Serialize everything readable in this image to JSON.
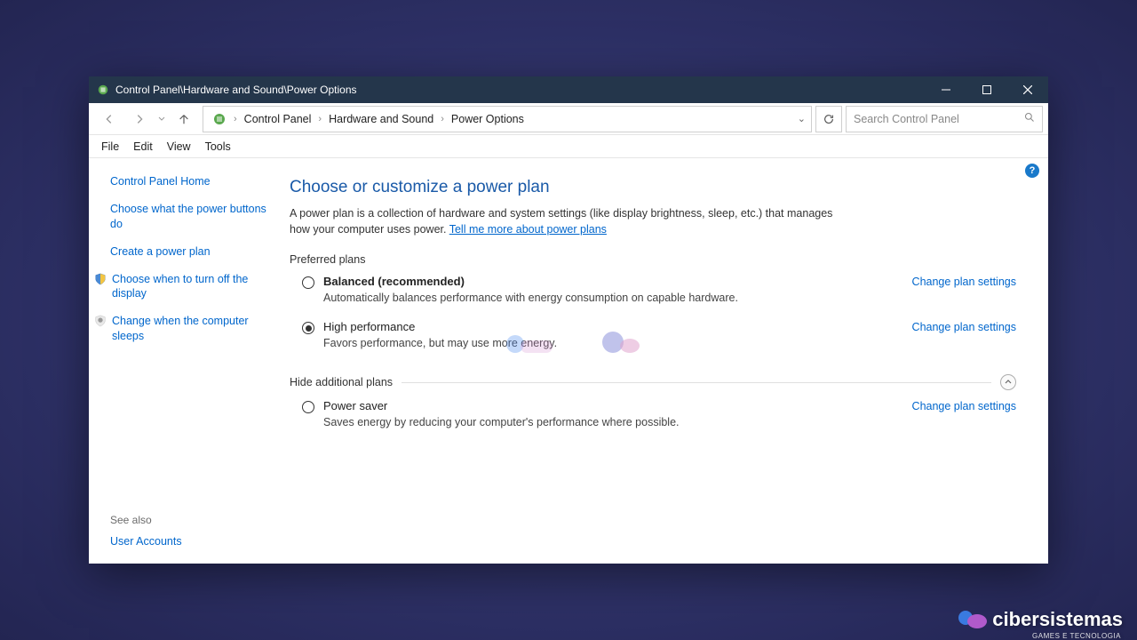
{
  "titlebar": {
    "title": "Control Panel\\Hardware and Sound\\Power Options"
  },
  "breadcrumbs": {
    "item0": "Control Panel",
    "item1": "Hardware and Sound",
    "item2": "Power Options"
  },
  "search": {
    "placeholder": "Search Control Panel"
  },
  "menu": {
    "file": "File",
    "edit": "Edit",
    "view": "View",
    "tools": "Tools"
  },
  "sidebar": {
    "home": "Control Panel Home",
    "link0": "Choose what the power buttons do",
    "link1": "Create a power plan",
    "link2": "Choose when to turn off the display",
    "link3": "Change when the computer sleeps",
    "see_also_label": "See also",
    "see_also_0": "User Accounts"
  },
  "main": {
    "heading": "Choose or customize a power plan",
    "desc_a": "A power plan is a collection of hardware and system settings (like display brightness, sleep, etc.) that manages how your computer uses power. ",
    "desc_link": "Tell me more about power plans",
    "preferred_label": "Preferred plans",
    "additional_label": "Hide additional plans",
    "change_label": "Change plan settings",
    "plans": {
      "balanced": {
        "name": "Balanced (recommended)",
        "desc": "Automatically balances performance with energy consumption on capable hardware."
      },
      "high": {
        "name": "High performance",
        "desc": "Favors performance, but may use more energy."
      },
      "saver": {
        "name": "Power saver",
        "desc": "Saves energy by reducing your computer's performance where possible."
      }
    }
  },
  "watermark": {
    "text": "cibersistemas",
    "sub": "GAMES E TECNOLOGIA"
  }
}
